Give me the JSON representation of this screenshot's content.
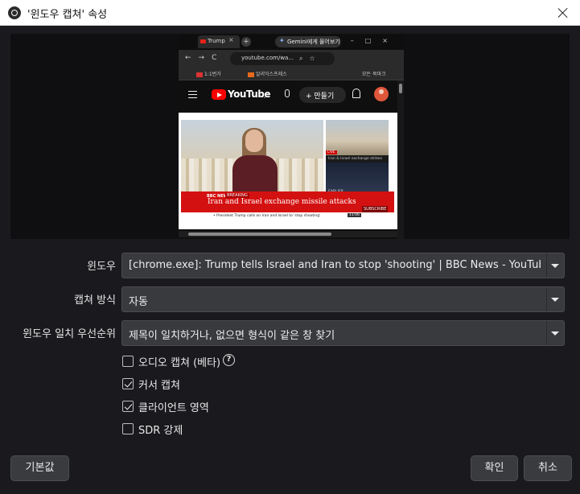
{
  "window": {
    "title": "'윈도우 캡쳐' 속성",
    "app_icon": "obs-icon",
    "close_icon": "close-icon"
  },
  "preview": {
    "browser": {
      "tab_title": "Trump",
      "tab_close": "×",
      "new_tab": "+",
      "gemini_button": "Gemini에게 물어보기",
      "window_controls": "–□×",
      "nav_icons": "←→C",
      "url": "youtube.com/wa...",
      "url_icons": "⌕☆",
      "bookmarks": {
        "item1": "1:1번가",
        "item2": "알리익스프레스",
        "all_bookmarks": "모든 북마크"
      }
    },
    "youtube": {
      "logo_text": "YouTube",
      "search_icon": "⌕",
      "create_label": "+ 만들기",
      "video": {
        "channel": "BBC NEWS",
        "breaking": "BREAKING",
        "headline": "Iran and Israel exchange missile attacks",
        "subscribe": "SUBSCRIBE",
        "ticker": "• President Trump calls on Iran and Israel to 'stop shooting'",
        "ticker_time": "11:06",
        "side_live": "LIVE",
        "side_caption": "Iran & Israel exchange strikes",
        "side_label": "EARLIER"
      }
    }
  },
  "form": {
    "window": {
      "label": "윈도우",
      "value": "[chrome.exe]: Trump tells Israel and Iran to stop 'shooting' | BBC News - YouTube - Ch"
    },
    "capture_method": {
      "label": "캡쳐 방식",
      "value": "자동"
    },
    "window_match_priority": {
      "label": "윈도우 일치 우선순위",
      "value": "제목이 일치하거나, 없으면 형식이 같은 창 찾기"
    },
    "checkboxes": [
      {
        "label": "오디오 캡쳐 (베타)",
        "checked": false,
        "has_help": true
      },
      {
        "label": "커서 캡쳐",
        "checked": true,
        "has_help": false
      },
      {
        "label": "클라이언트 영역",
        "checked": true,
        "has_help": false
      },
      {
        "label": "SDR 강제",
        "checked": false,
        "has_help": false
      }
    ],
    "help_glyph": "?"
  },
  "buttons": {
    "defaults": "기본값",
    "ok": "확인",
    "cancel": "취소"
  }
}
